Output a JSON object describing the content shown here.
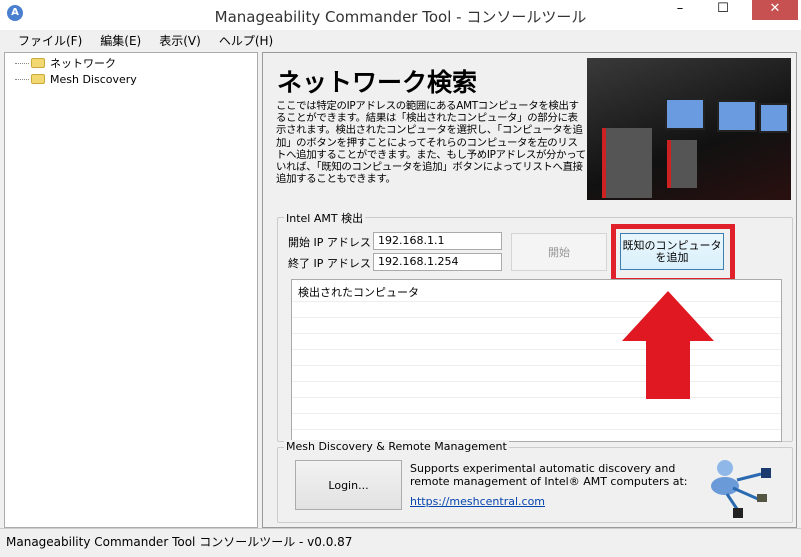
{
  "window": {
    "title": "Manageability Commander Tool - コンソールツール",
    "minimize": "–",
    "maximize": "☐",
    "close": "✕",
    "app_icon": "A"
  },
  "menu": [
    "ファイル(F)",
    "編集(E)",
    "表示(V)",
    "ヘルプ(H)"
  ],
  "tree": [
    "ネットワーク",
    "Mesh Discovery"
  ],
  "main": {
    "heading": "ネットワーク検索",
    "description": "ここでは特定のIPアドレスの範囲にあるAMTコンピュータを検出することができます。結果は「検出されたコンピュータ」の部分に表示されます。検出されたコンピュータを選択し、「コンピュータを追加」のボタンを押すことによってそれらのコンピュータを左のリストへ追加することができます。また、もし予めIPアドレスが分かっていれば、「既知のコンピュータを追加」ボタンによってリストへ直接追加することもできます。",
    "amt_group": {
      "title": "Intel AMT 検出",
      "start_ip_label": "開始 IP アドレス",
      "start_ip": "192.168.1.1",
      "end_ip_label": "終了 IP アドレス",
      "end_ip": "192.168.1.254",
      "start_button": "開始",
      "add_known_line1": "既知のコンピュータ",
      "add_known_line2": "を追加",
      "list_header": "検出されたコンピュータ"
    },
    "mesh_group": {
      "title": "Mesh Discovery & Remote Management",
      "login_button": "Login...",
      "info_line1": "Supports experimental automatic discovery and",
      "info_line2": "remote management of Intel® AMT computers at:",
      "link": "https://meshcentral.com"
    }
  },
  "status": "Manageability Commander Tool コンソールツール - v0.0.87",
  "colors": {
    "highlight": "#e0202a",
    "close": "#c75050"
  }
}
